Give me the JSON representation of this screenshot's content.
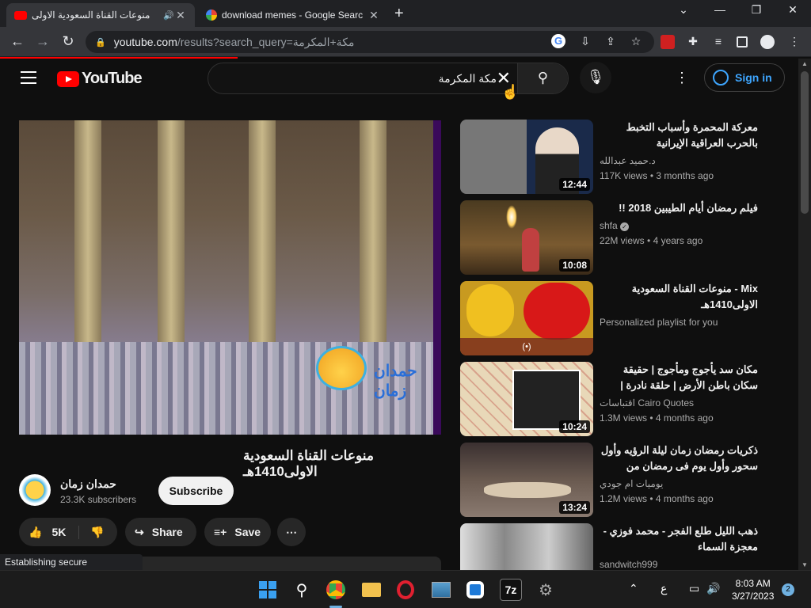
{
  "browser": {
    "tabs": [
      {
        "title": "منوعات القناة السعودية الاولى",
        "active": true
      },
      {
        "title": "download memes - Google Search",
        "active": false
      }
    ],
    "url_host": "youtube.com",
    "url_path": "/results?search_query=مكة+المكرمة"
  },
  "youtube": {
    "logo_text": "YouTube",
    "search_query": "مكة المكرمة",
    "signin_label": "Sign in"
  },
  "video": {
    "watermark": "حمدان زمان",
    "title": "منوعات القناة السعودية الاولى1410هـ",
    "channel": "حمدان زمان",
    "subscribers": "23.3K subscribers",
    "subscribe_label": "Subscribe",
    "likes": "5K",
    "share_label": "Share",
    "save_label": "Save"
  },
  "status_text": "Establishing secure connection...",
  "sidebar": [
    {
      "title": "معركة المحمرة وأسباب التخبط بالحرب العراقية الإيرانية",
      "channel": "د.حميد عبدالله",
      "views": "117K views",
      "age": "3 months ago",
      "duration": "12:44",
      "rtl": true
    },
    {
      "title": "فيلم رمضان أيام الطيبين 2018 !!",
      "channel": "shfa",
      "views": "22M views",
      "age": "4 years ago",
      "duration": "10:08",
      "rtl": true,
      "verified": true
    },
    {
      "title": "Mix - منوعات القناة السعودية الاولى1410هـ",
      "channel": "Personalized playlist for you",
      "views": "",
      "age": "",
      "duration": "",
      "rtl": true
    },
    {
      "title": "مكان سد يأجوج ومأجوج | حقيقة سكان باطن الأرض | حلقة نادرة | جودة عالية خرائط ...",
      "channel": "اقتباسات Cairo Quotes",
      "views": "1.3M views",
      "age": "4 months ago",
      "duration": "10:24",
      "rtl": true
    },
    {
      "title": "ذكريات رمضان زمان ليلة الرؤيه وأول سحور وأول يوم فى رمضان من مسلسل ساكن ...",
      "channel": "يوميات ام جودي",
      "views": "1.2M views",
      "age": "4 months ago",
      "duration": "13:24",
      "rtl": true
    },
    {
      "title": "ذهب الليل طلع الفجر - محمد فوزي - معجزة السماء",
      "channel": "sandwitch999",
      "views": "",
      "age": "",
      "duration": "",
      "rtl": true
    }
  ],
  "taskbar": {
    "lang": "ع",
    "time": "8:03 AM",
    "date": "3/27/2023",
    "notifications": "2"
  }
}
